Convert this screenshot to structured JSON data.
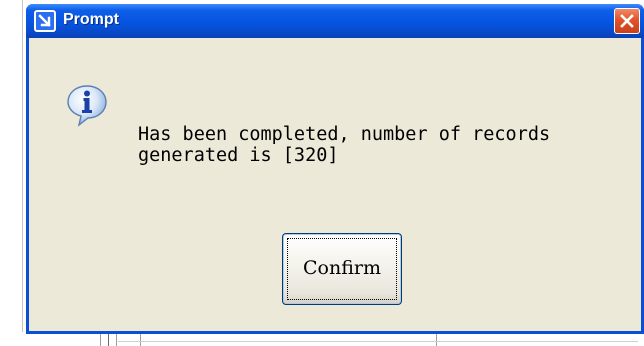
{
  "dialog": {
    "title": "Prompt",
    "message": "Has been completed, number of records\ngenerated is [320]",
    "confirm_label": "Confirm",
    "icons": {
      "app": "arrow-down-right-icon",
      "message": "information-icon",
      "close": "close-icon"
    }
  },
  "colors": {
    "titlebar": "#0654e0",
    "client_bg": "#ece9d8",
    "close_button": "#e2542a",
    "button_border": "#003c74"
  }
}
